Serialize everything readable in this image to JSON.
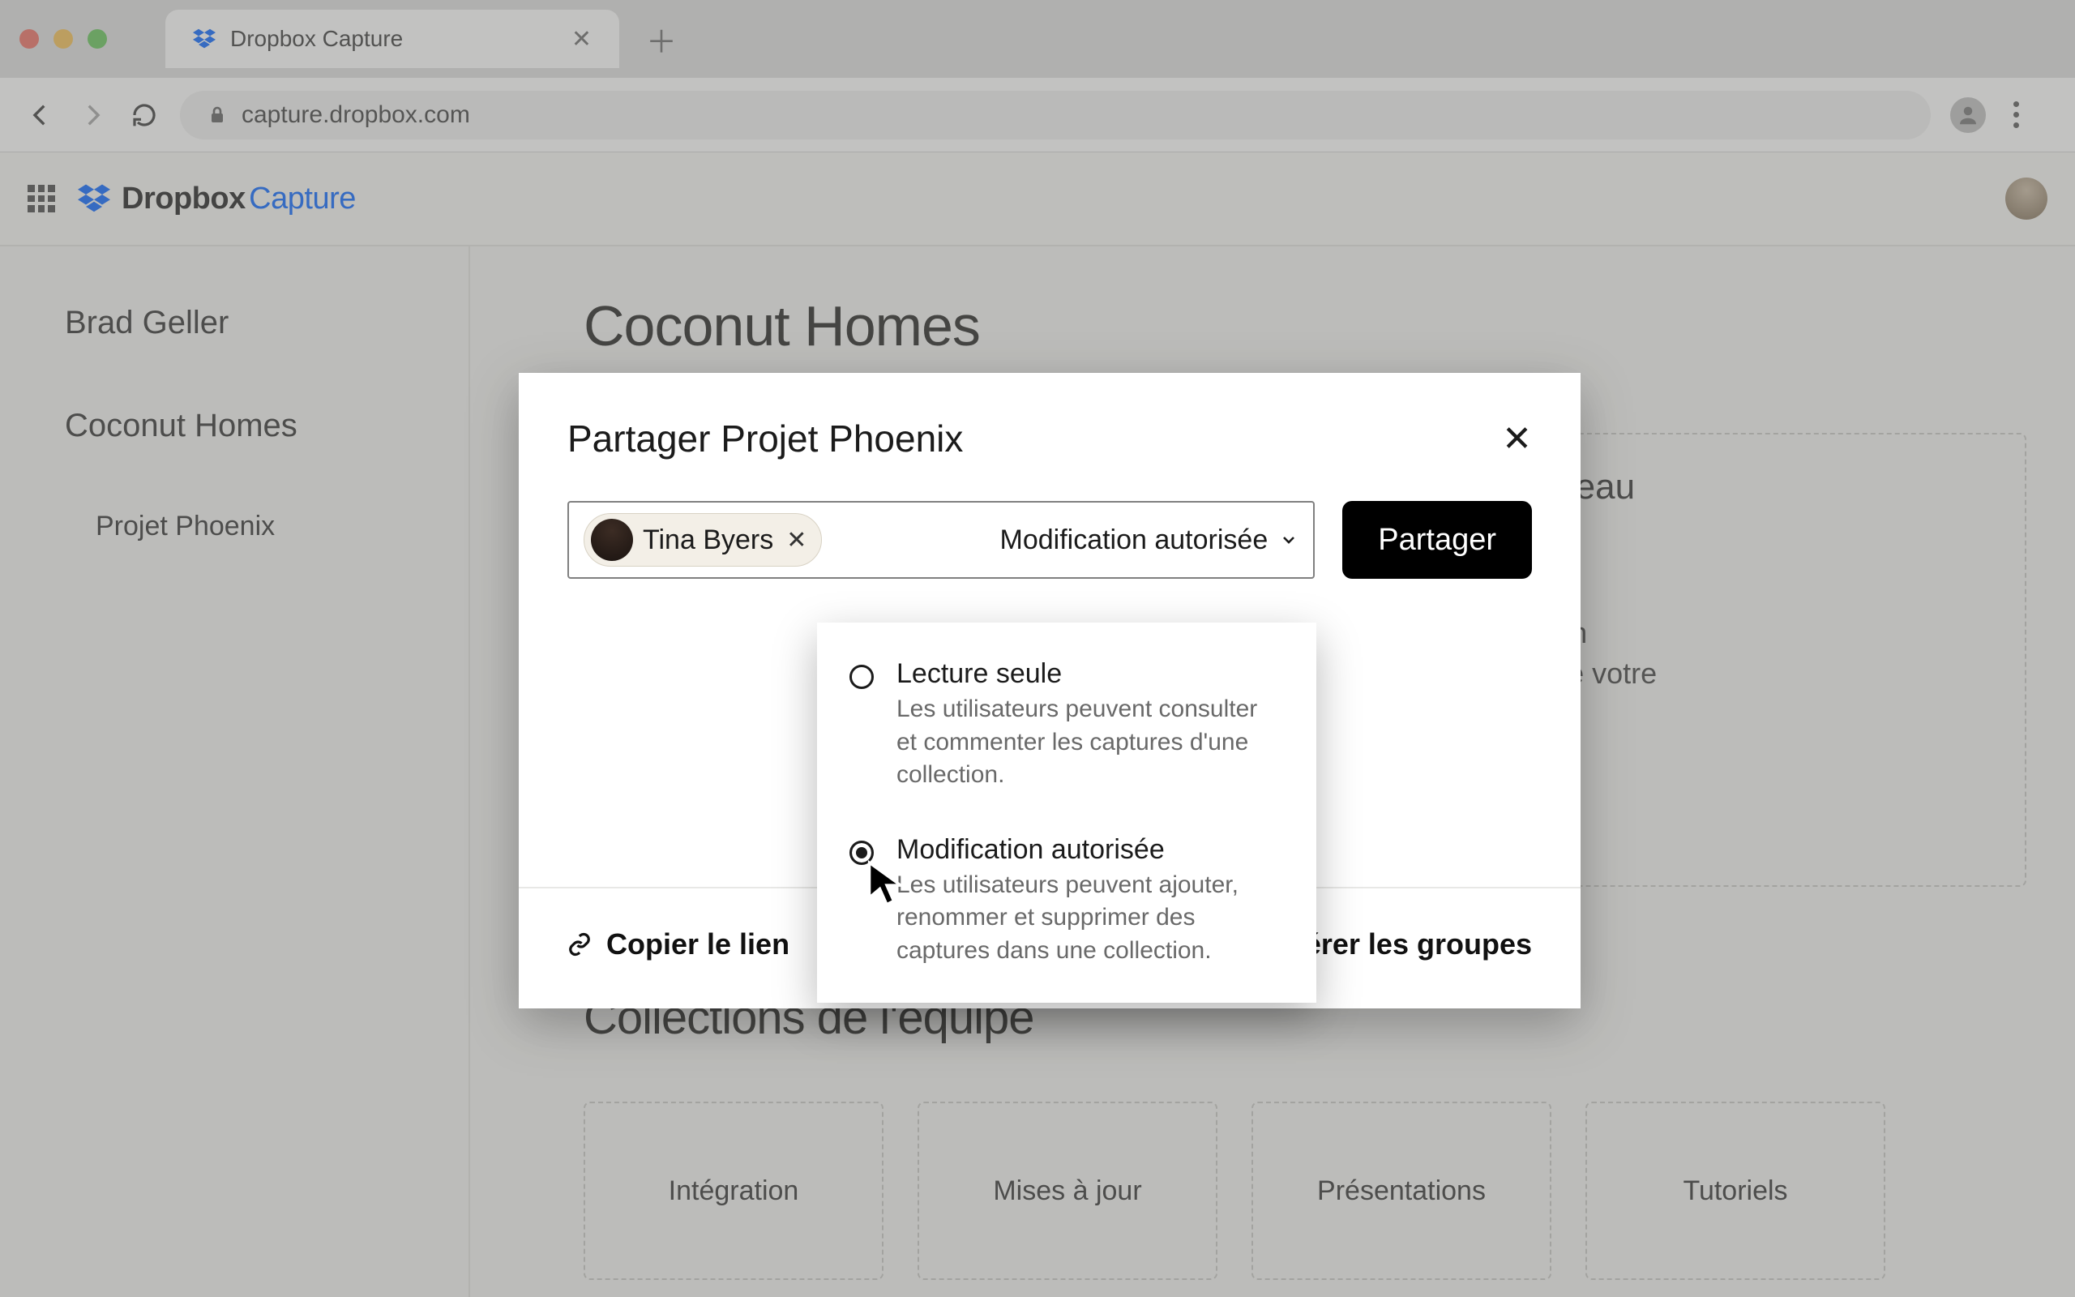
{
  "browser": {
    "tab_title": "Dropbox Capture",
    "url": "capture.dropbox.com"
  },
  "app": {
    "logo1": "Dropbox",
    "logo2": "Capture"
  },
  "sidebar": {
    "items": [
      {
        "label": "Brad Geller"
      },
      {
        "label": "Coconut Homes"
      },
      {
        "label": "Projet Phoenix"
      }
    ]
  },
  "page": {
    "title": "Coconut Homes",
    "share_card": {
      "header_suffix": "nouveau",
      "body_l1": "collection",
      "body_l2": "membres de votre"
    },
    "section_title": "Collections de l'équipe",
    "collections": [
      {
        "label": "Intégration"
      },
      {
        "label": "Mises à jour"
      },
      {
        "label": "Présentations"
      },
      {
        "label": "Tutoriels"
      }
    ]
  },
  "modal": {
    "title": "Partager Projet Phoenix",
    "chip_name": "Tina Byers",
    "permission_selected": "Modification autorisée",
    "share_button": "Partager",
    "copy_link": "Copier le lien",
    "manage_groups": "Gérer les groupes",
    "options": [
      {
        "title": "Lecture seule",
        "desc": "Les utilisateurs peuvent consulter et commenter les captures d'une collection.",
        "selected": false
      },
      {
        "title": "Modification autorisée",
        "desc": "Les utilisateurs peuvent ajouter, renommer et supprimer des captures dans une collection.",
        "selected": true
      }
    ]
  }
}
